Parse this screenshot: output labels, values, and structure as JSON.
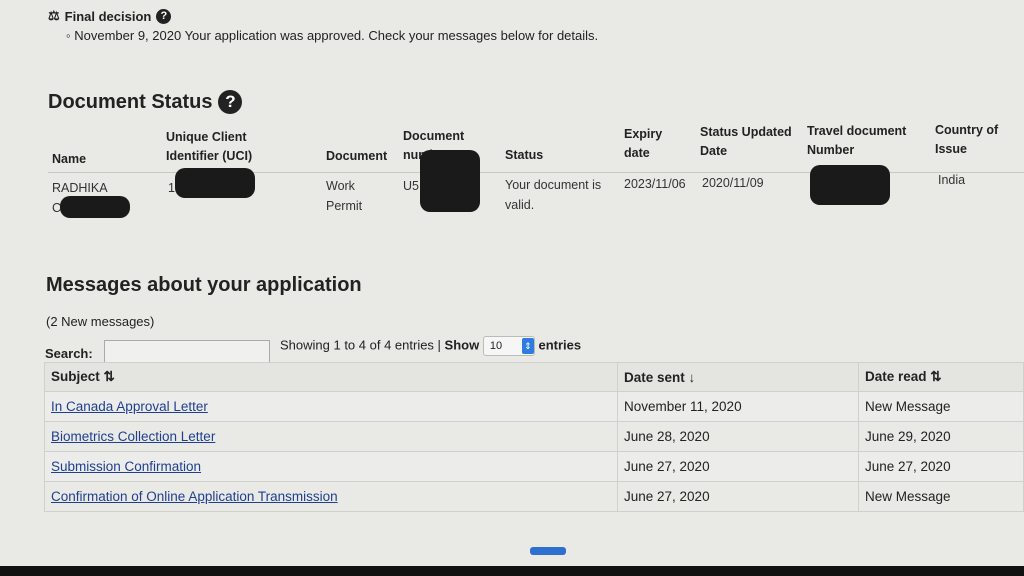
{
  "final_decision": {
    "title": "Final decision",
    "icon": "scales-icon",
    "text": "November 9, 2020 Your application was approved. Check your messages below for details."
  },
  "document_status": {
    "title": "Document Status",
    "headers": {
      "name": "Name",
      "uci": "Unique Client Identifier (UCI)",
      "document": "Document",
      "document_number": "Document number",
      "status": "Status",
      "expiry": "Expiry date",
      "status_updated": "Status Updated Date",
      "travel_doc": "Travel document Number",
      "country": "Country of Issue"
    },
    "row": {
      "name": "RADHIKA",
      "name_partial": "CH",
      "uci_partial": "1",
      "document": "Work Permit",
      "document_number_partial": "U5",
      "status": "Your document is valid.",
      "expiry": "2023/11/06",
      "status_updated": "2020/11/09",
      "travel_doc": "",
      "country": "India"
    }
  },
  "messages": {
    "title": "Messages about your application",
    "new_count": "(2 New messages)",
    "search_label": "Search:",
    "search_value": "",
    "showing": "Showing 1 to 4 of 4 entries",
    "show_label": "Show",
    "show_value": "10",
    "entries_label": "entries",
    "headers": {
      "subject": "Subject ⇅",
      "date_sent": "Date sent ↓",
      "date_read": "Date read ⇅"
    },
    "rows": [
      {
        "subject": "In Canada Approval Letter",
        "date_sent": "November 11, 2020",
        "date_read": "New Message"
      },
      {
        "subject": "Biometrics Collection Letter",
        "date_sent": "June 28, 2020",
        "date_read": "June 29, 2020"
      },
      {
        "subject": "Submission Confirmation",
        "date_sent": "June 27, 2020",
        "date_read": "June 27, 2020"
      },
      {
        "subject": "Confirmation of Online Application Transmission",
        "date_sent": "June 27, 2020",
        "date_read": "New Message"
      }
    ]
  }
}
